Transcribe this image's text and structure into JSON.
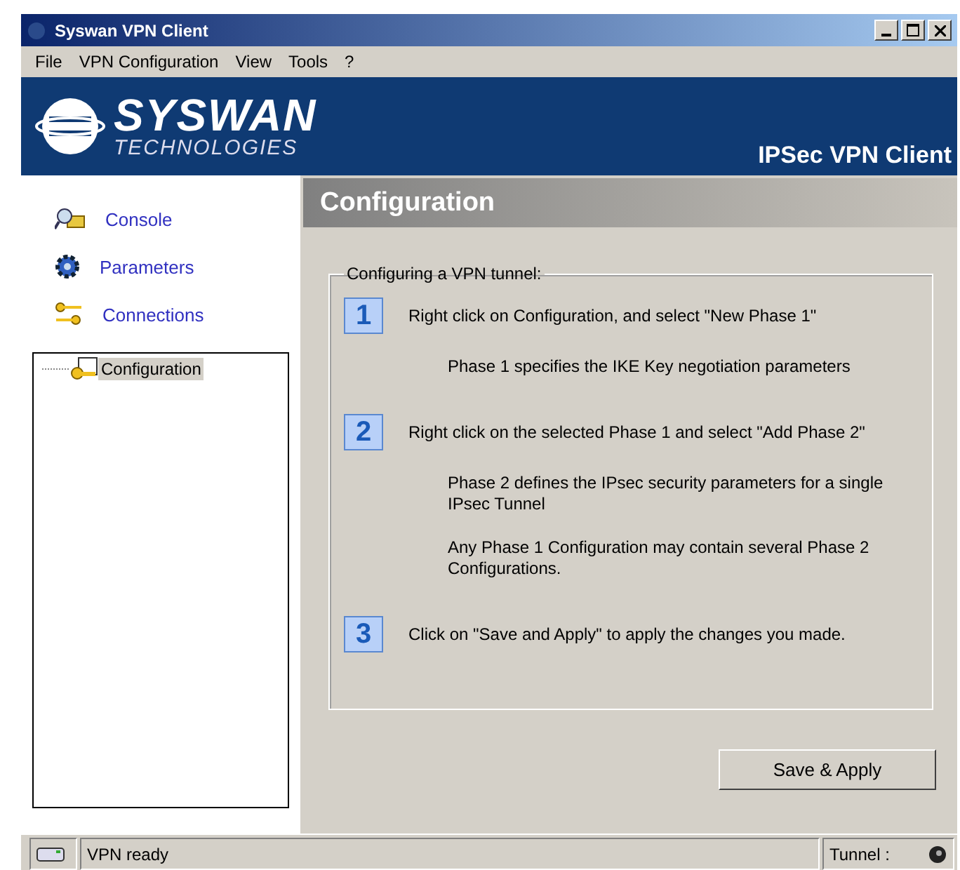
{
  "window": {
    "title": "Syswan VPN Client"
  },
  "menu": [
    "File",
    "VPN Configuration",
    "View",
    "Tools",
    "?"
  ],
  "banner": {
    "logo_name": "SYSWAN",
    "logo_sub": "TECHNOLOGIES",
    "product": "IPSec VPN Client"
  },
  "sidebar": {
    "items": [
      {
        "label": "Console",
        "kind": "console"
      },
      {
        "label": "Parameters",
        "kind": "parameters"
      },
      {
        "label": "Connections",
        "kind": "connections"
      }
    ]
  },
  "tree": {
    "items": [
      {
        "label": "Configuration",
        "selected": true
      }
    ]
  },
  "panel": {
    "title": "Configuration",
    "group_title": "Configuring a VPN tunnel:",
    "steps": [
      {
        "number": "1",
        "text": "Right click on Configuration, and select \"New Phase 1\"",
        "notes": [
          "Phase 1 specifies the IKE Key negotiation parameters"
        ]
      },
      {
        "number": "2",
        "text": "Right click on the selected Phase 1 and select \"Add Phase 2\"",
        "notes": [
          "Phase 2 defines the IPsec security parameters for a single IPsec Tunnel",
          "Any Phase 1 Configuration may contain several Phase 2 Configurations."
        ]
      },
      {
        "number": "3",
        "text": "Click on \"Save and Apply\" to apply the changes you made."
      }
    ],
    "button": "Save & Apply"
  },
  "status_bar": {
    "message": "VPN ready",
    "tunnel_label": "Tunnel :"
  }
}
